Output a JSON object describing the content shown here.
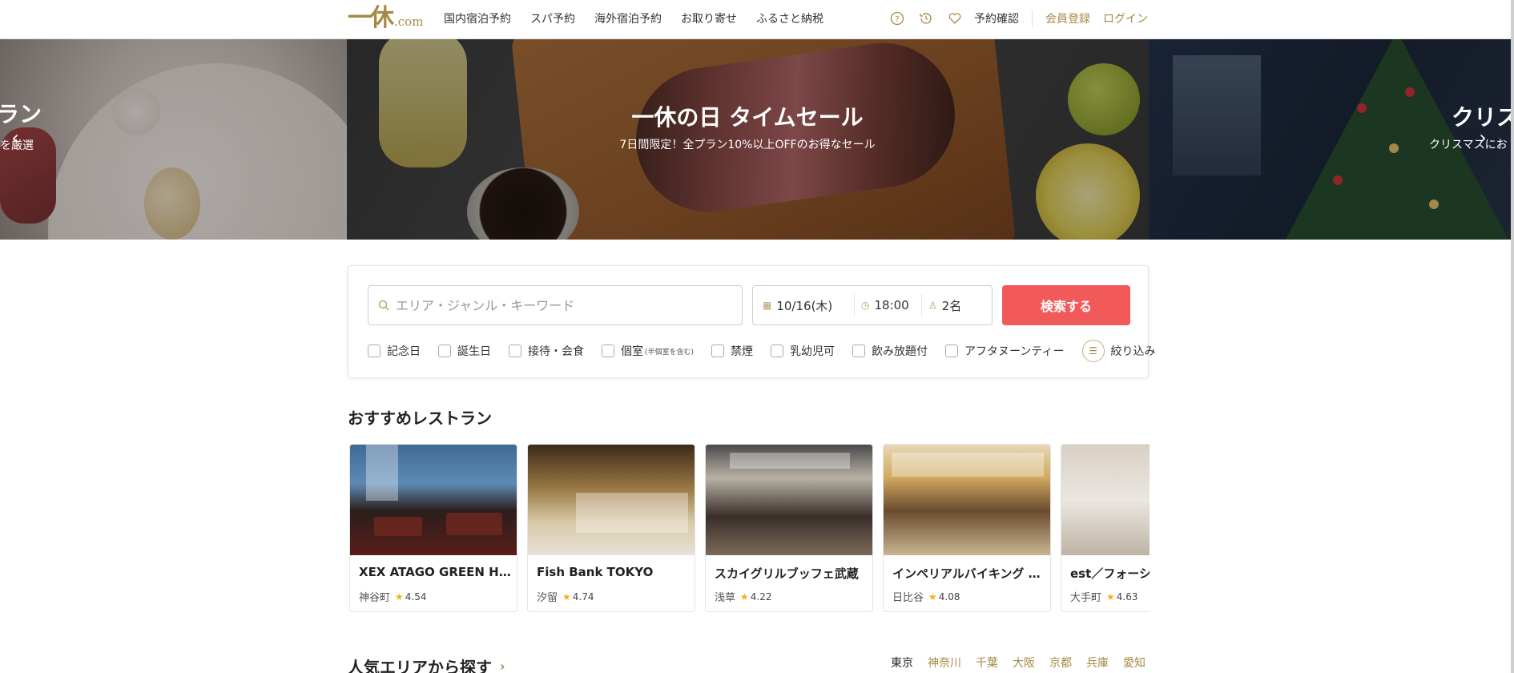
{
  "header": {
    "logo_mark": "一休",
    "logo_suffix": ".com",
    "nav": [
      {
        "label": "国内宿泊予約"
      },
      {
        "label": "スパ予約"
      },
      {
        "label": "海外宿泊予約"
      },
      {
        "label": "お取り寄せ"
      },
      {
        "label": "ふるさと納税"
      }
    ],
    "icons": [
      "help-icon",
      "history-icon",
      "heart-icon"
    ],
    "reservation_label": "予約確認",
    "register_label": "会員登録",
    "login_label": "ログイン"
  },
  "hero": {
    "left": {
      "title": "ラン",
      "subtitle": "を厳選"
    },
    "main": {
      "title": "一休の日 タイムセール",
      "subtitle": "7日間限定！全プラン10%以上OFFのお得なセール"
    },
    "right": {
      "title": "クリス",
      "subtitle": "クリスマスにお"
    },
    "prev_icon": "‹",
    "next_icon": "›"
  },
  "search": {
    "keyword_placeholder": "エリア・ジャンル・キーワード",
    "date": "10/16(木)",
    "time": "18:00",
    "people": "2名",
    "button_label": "検索する",
    "filters": [
      {
        "label": "記念日"
      },
      {
        "label": "誕生日"
      },
      {
        "label": "接待・会食"
      },
      {
        "label": "個室",
        "note": "(半個室を含む)"
      },
      {
        "label": "禁煙"
      },
      {
        "label": "乳幼児可"
      },
      {
        "label": "飲み放題付"
      },
      {
        "label": "アフタヌーンティー"
      }
    ],
    "narrow_label": "絞り込み"
  },
  "recommended": {
    "title": "おすすめレストラン",
    "cards": [
      {
        "name": "XEX ATAGO GREEN HILLS",
        "area": "神谷町",
        "rating": "4.54"
      },
      {
        "name": "Fish Bank TOKYO",
        "area": "汐留",
        "rating": "4.74"
      },
      {
        "name": "スカイグリルブッフェ武蔵",
        "area": "浅草",
        "rating": "4.22"
      },
      {
        "name": "インペリアルバイキング サール",
        "area": "日比谷",
        "rating": "4.08"
      },
      {
        "name": "est／フォーシーズンズ",
        "area": "大手町",
        "rating": "4.63"
      }
    ]
  },
  "areas": {
    "title": "人気エリアから探す",
    "links": [
      {
        "label": "東京",
        "active": true
      },
      {
        "label": "神奈川"
      },
      {
        "label": "千葉"
      },
      {
        "label": "大阪"
      },
      {
        "label": "京都"
      },
      {
        "label": "兵庫"
      },
      {
        "label": "愛知"
      }
    ]
  },
  "colors": {
    "brand_gold": "#a58a45",
    "search_button": "#f25a5a",
    "star": "#f2b01e"
  }
}
